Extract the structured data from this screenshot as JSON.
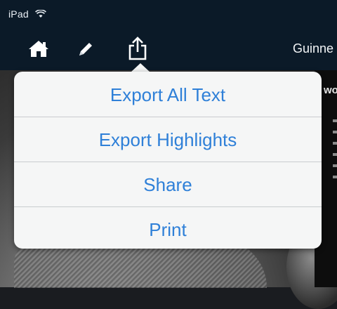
{
  "status_bar": {
    "carrier": "iPad"
  },
  "toolbar": {
    "document_title": "Guinne"
  },
  "export_menu": {
    "items": [
      {
        "label": "Export All Text"
      },
      {
        "label": "Export Highlights"
      },
      {
        "label": "Share"
      },
      {
        "label": "Print"
      }
    ]
  },
  "background": {
    "right_heading": "wo"
  },
  "colors": {
    "accent": "#2f80d8",
    "toolbar": "#0b1a28",
    "popover": "#f5f6f6"
  },
  "icons": [
    "wifi-icon",
    "home-icon",
    "pencil-icon",
    "share-icon"
  ]
}
